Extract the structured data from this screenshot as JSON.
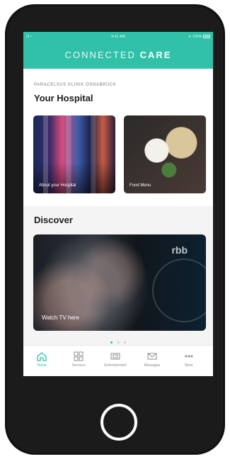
{
  "status_bar": {
    "carrier": "ıll ⌁",
    "time": "9:41 AM",
    "battery": "100%"
  },
  "app_bar": {
    "brand_light": "CONNECTED",
    "brand_bold": "CARE"
  },
  "hospital": {
    "kicker": "PARACELSUS KLINIK OSNABRÜCK",
    "title": "Your Hospital",
    "cards": [
      {
        "caption": "About your Hospital"
      },
      {
        "caption": "Food Menu"
      }
    ]
  },
  "discover": {
    "title": "Discover",
    "card": {
      "watermark": "rbb",
      "caption": "Watch TV here"
    },
    "pager": {
      "active_index": 0,
      "count": 3
    }
  },
  "tabs": [
    {
      "label": "Home",
      "icon": "home-icon",
      "active": true
    },
    {
      "label": "Services",
      "icon": "grid-icon",
      "active": false
    },
    {
      "label": "Entertainment",
      "icon": "tv-icon",
      "active": false
    },
    {
      "label": "Messages",
      "icon": "mail-icon",
      "active": false
    },
    {
      "label": "More",
      "icon": "more-icon",
      "active": false
    }
  ],
  "colors": {
    "accent": "#30c1a8",
    "phone": "#121212"
  }
}
